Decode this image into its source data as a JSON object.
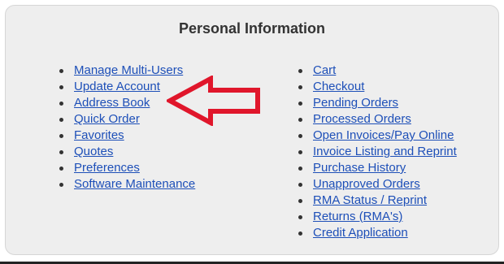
{
  "panel": {
    "title": "Personal Information"
  },
  "left_links": [
    {
      "label": "Manage Multi-Users"
    },
    {
      "label": "Update Account"
    },
    {
      "label": "Address Book"
    },
    {
      "label": "Quick Order"
    },
    {
      "label": "Favorites"
    },
    {
      "label": "Quotes"
    },
    {
      "label": "Preferences"
    },
    {
      "label": "Software Maintenance"
    }
  ],
  "right_links": [
    {
      "label": "Cart"
    },
    {
      "label": "Checkout"
    },
    {
      "label": "Pending Orders"
    },
    {
      "label": "Processed Orders"
    },
    {
      "label": "Open Invoices/Pay Online"
    },
    {
      "label": "Invoice Listing and Reprint"
    },
    {
      "label": "Purchase History"
    },
    {
      "label": "Unapproved Orders"
    },
    {
      "label": "RMA Status / Reprint"
    },
    {
      "label": "Returns (RMA's)"
    },
    {
      "label": "Credit Application"
    }
  ],
  "annotation": {
    "icon": "left-arrow-icon",
    "color": "#e0162b",
    "points_to": "Address Book"
  },
  "colors": {
    "link": "#1d4fb8",
    "panel_bg": "#eeeeee"
  }
}
